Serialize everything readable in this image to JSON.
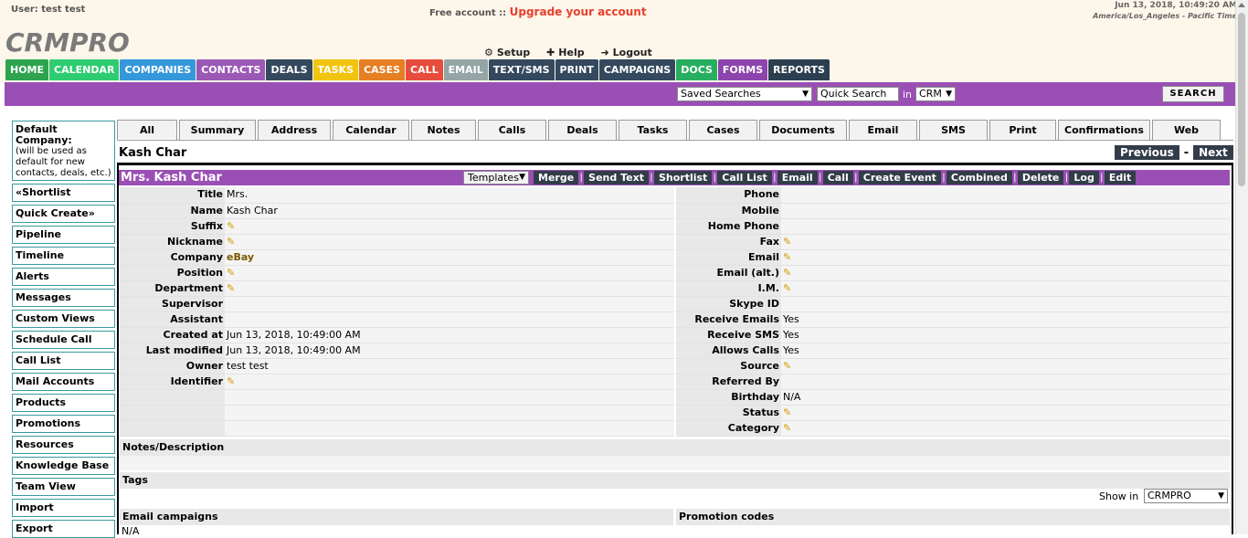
{
  "header": {
    "user_label": "User: test test",
    "free_account": "Free account ::",
    "upgrade_link": "Upgrade your account",
    "datetime": "Jun 13, 2018, 10:49:20 AM",
    "timezone": "America/Los_Angeles - Pacific Time",
    "logo": "CRMPRO",
    "setup": "Setup",
    "help": "Help",
    "logout": "Logout"
  },
  "nav": [
    {
      "label": "HOME",
      "color": "#2ea44f"
    },
    {
      "label": "CALENDAR",
      "color": "#2ecc71"
    },
    {
      "label": "COMPANIES",
      "color": "#3498db"
    },
    {
      "label": "CONTACTS",
      "color": "#9b59b6"
    },
    {
      "label": "DEALS",
      "color": "#34495e"
    },
    {
      "label": "TASKS",
      "color": "#f1c40f"
    },
    {
      "label": "CASES",
      "color": "#e67e22"
    },
    {
      "label": "CALL",
      "color": "#e74c3c"
    },
    {
      "label": "EMAIL",
      "color": "#95a5a6"
    },
    {
      "label": "TEXT/SMS",
      "color": "#34495e"
    },
    {
      "label": "PRINT",
      "color": "#34495e"
    },
    {
      "label": "CAMPAIGNS",
      "color": "#34495e"
    },
    {
      "label": "DOCS",
      "color": "#27ae60"
    },
    {
      "label": "FORMS",
      "color": "#8e44ad"
    },
    {
      "label": "REPORTS",
      "color": "#2c3e50"
    }
  ],
  "search": {
    "saved_searches": "Saved Searches",
    "quick_search_value": "Quick Search",
    "in_label": "in",
    "crm_value": "CRM",
    "search_button": "SEARCH"
  },
  "sidebar": {
    "default_company_title": "Default Company:",
    "default_company_note": "(will be used as default for new contacts, deals, etc.)",
    "items": [
      "«Shortlist",
      "Quick Create»",
      "Pipeline",
      "Timeline",
      "Alerts",
      "Messages",
      "Custom Views",
      "Schedule Call",
      "Call List",
      "Mail Accounts",
      "Products",
      "Promotions",
      "Resources",
      "Knowledge Base",
      "Team View",
      "Import",
      "Export"
    ]
  },
  "tabs": [
    "All",
    "Summary",
    "Address",
    "Calendar",
    "Notes",
    "Calls",
    "Deals",
    "Tasks",
    "Cases",
    "Documents",
    "Email",
    "SMS",
    "Print",
    "Confirmations",
    "Web"
  ],
  "contact": {
    "name": "Kash Char",
    "previous": "Previous",
    "dash": "-",
    "next": "Next",
    "record_title": "Mrs. Kash Char",
    "templates": "Templates",
    "actions": [
      "Merge",
      "Send Text",
      "Shortlist",
      "Call List",
      "Email",
      "Call",
      "Create Event",
      "Combined",
      "Delete",
      "Log",
      "Edit"
    ]
  },
  "left_fields": [
    {
      "label": "Title",
      "value": "Mrs."
    },
    {
      "label": "Name",
      "value": "Kash Char"
    },
    {
      "label": "Suffix",
      "value": "",
      "edit": true
    },
    {
      "label": "Nickname",
      "value": "",
      "edit": true
    },
    {
      "label": "Company",
      "value": "eBay",
      "link": true
    },
    {
      "label": "Position",
      "value": "",
      "edit": true
    },
    {
      "label": "Department",
      "value": "",
      "edit": true
    },
    {
      "label": "Supervisor",
      "value": ""
    },
    {
      "label": "Assistant",
      "value": ""
    },
    {
      "label": "Created at",
      "value": "Jun 13, 2018, 10:49:00 AM"
    },
    {
      "label": "Last modified",
      "value": "Jun 13, 2018, 10:49:00 AM"
    },
    {
      "label": "Owner",
      "value": "test test"
    },
    {
      "label": "Identifier",
      "value": "",
      "edit": true
    },
    {
      "label": "",
      "value": ""
    },
    {
      "label": "",
      "value": ""
    },
    {
      "label": "",
      "value": ""
    }
  ],
  "right_fields": [
    {
      "label": "Phone",
      "value": ""
    },
    {
      "label": "Mobile",
      "value": ""
    },
    {
      "label": "Home Phone",
      "value": ""
    },
    {
      "label": "Fax",
      "value": "",
      "edit": true
    },
    {
      "label": "Email",
      "value": "",
      "edit": true
    },
    {
      "label": "Email (alt.)",
      "value": "",
      "edit": true
    },
    {
      "label": "I.M.",
      "value": "",
      "edit": true
    },
    {
      "label": "Skype ID",
      "value": ""
    },
    {
      "label": "Receive Emails",
      "value": "Yes"
    },
    {
      "label": "Receive SMS",
      "value": "Yes"
    },
    {
      "label": "Allows Calls",
      "value": "Yes"
    },
    {
      "label": "Source",
      "value": "",
      "edit": true
    },
    {
      "label": "Referred By",
      "value": ""
    },
    {
      "label": "Birthday",
      "value": "N/A"
    },
    {
      "label": "Status",
      "value": "",
      "edit": true
    },
    {
      "label": "Category",
      "value": "",
      "edit": true
    }
  ],
  "sections": {
    "notes": "Notes/Description",
    "tags": "Tags",
    "show_in_label": "Show in",
    "show_in_value": "CRMPRO",
    "email_campaigns": "Email campaigns",
    "promotion_codes": "Promotion codes",
    "email_campaigns_value": "N/A"
  },
  "colors": {
    "purple_bar": "#9a4fb5",
    "dark_button": "#333d4a",
    "upgrade": "#e8402e"
  }
}
